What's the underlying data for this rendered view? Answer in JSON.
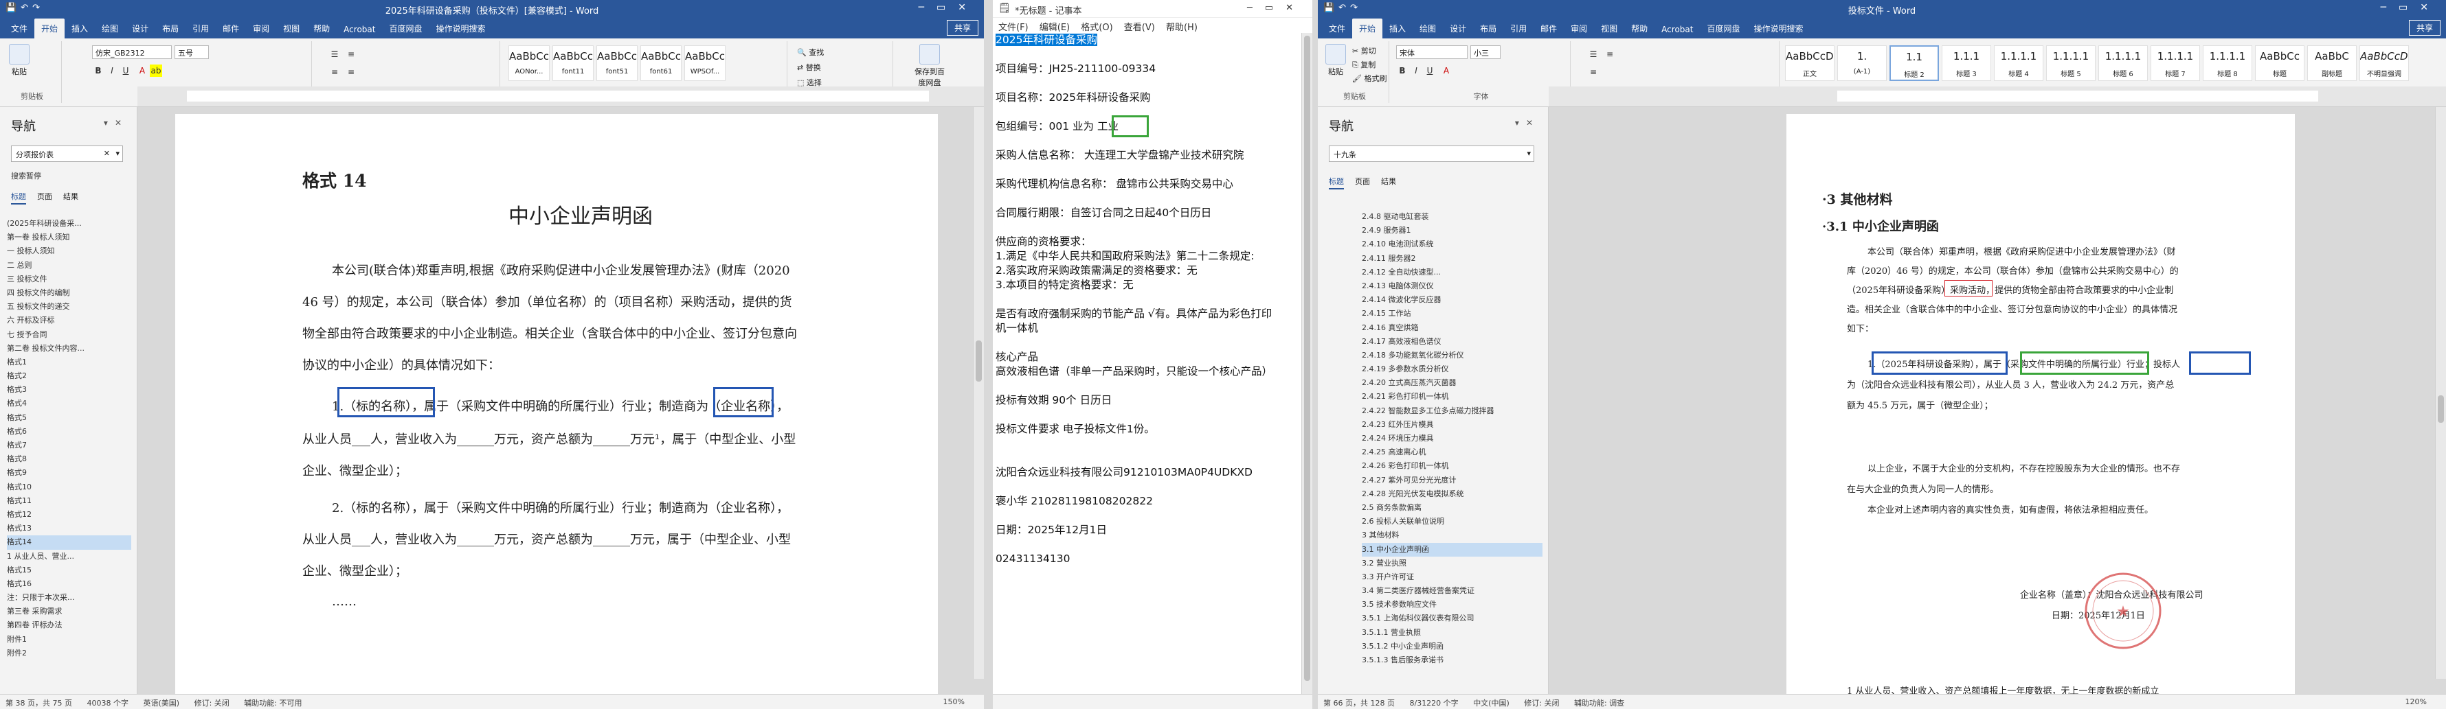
{
  "left_word": {
    "title": "2025年科研设备采购（投标文件）[兼容模式] - Word",
    "share": "共享",
    "tabs": [
      "文件",
      "开始",
      "插入",
      "绘图",
      "设计",
      "布局",
      "引用",
      "邮件",
      "审阅",
      "视图",
      "帮助",
      "Acrobat",
      "百度网盘",
      "操作说明搜索"
    ],
    "font_name": "仿宋_GB2312",
    "font_size": "五号",
    "styles": [
      {
        "preview": "AaBbCcDd",
        "name": "AONor..."
      },
      {
        "preview": "AaBbCcDd",
        "name": "font11"
      },
      {
        "preview": "AaBbCcDd",
        "name": "font51"
      },
      {
        "preview": "AaBbCcDd",
        "name": "font61"
      },
      {
        "preview": "AaBbCcDd",
        "name": "WPSOf..."
      }
    ],
    "ribbon_groups": {
      "clipboard": "剪贴板",
      "font": "字体",
      "paragraph": "段落",
      "styles": "样式",
      "edit": "编辑",
      "save": "保存",
      "paste": "粘贴",
      "find": "查找",
      "replace": "替换",
      "select": "选择",
      "save_to_baidu": "保存到百度网盘"
    },
    "nav": {
      "title": "导航",
      "search": "分项报价表",
      "results_label": "搜索暂停",
      "tabs": [
        "标题",
        "页面",
        "结果"
      ],
      "items": [
        "(2025年科研设备采...",
        "第一卷 投标人须知",
        "一 投标人须知",
        "二 总则",
        "三 投标文件",
        "四 投标文件的编制",
        "五 投标文件的递交",
        "六 开标及评标",
        "七 授予合同",
        "第二卷 投标文件内容...",
        "格式1",
        "格式2",
        "格式3",
        "格式4",
        "格式5",
        "格式6",
        "格式7",
        "格式8",
        "格式9",
        "格式10",
        "格式11",
        "格式12",
        "格式13",
        "格式14",
        "1 从业人员、营业...",
        "格式15",
        "格式16",
        "注：只限于本次采...",
        "第三卷 采购需求",
        "第四卷 评标办法",
        "附件1",
        "附件2"
      ],
      "selected_index": 23
    },
    "doc": {
      "heading": "格式 14",
      "title": "中小企业声明函",
      "body": [
        "本公司(联合体)郑重声明,根据《政府采购促进中小企业发展管理办法》(财库（2020",
        "46 号）的规定，本公司（联合体）参加（单位名称）的（项目名称）采购活动，提供的货",
        "物全部由符合政策要求的中小企业制造。相关企业（含联合体中的中小企业、签订分包意向",
        "协议的中小企业）的具体情况如下："
      ],
      "item1_a": "1.（标的名称），属于（采购文件中明确的所属行业）行业；制造商为（企业名称），",
      "item1_b": "从业人员___人，营业收入为______万元，资产总额为______万元¹，属于（中型企业、小型",
      "item1_c": "企业、微型企业）；",
      "item2_a": "2.（标的名称），属于（采购文件中明确的所属行业）行业；制造商为（企业名称），",
      "item2_b": "从业人员___人，营业收入为______万元，资产总额为______万元，属于（中型企业、小型",
      "item2_c": "企业、微型企业）；",
      "ellipsis": "……"
    },
    "status": {
      "page": "第 38 页，共 75 页",
      "words": "40038 个字",
      "lang": "英语(美国)",
      "track": "修订: 关闭",
      "access": "辅助功能: 不可用",
      "zoom": "150%"
    }
  },
  "notepad": {
    "title": "*无标题 - 记事本",
    "menu": [
      "文件(F)",
      "编辑(E)",
      "格式(O)",
      "查看(V)",
      "帮助(H)"
    ],
    "lines": [
      "2025年科研设备采购",
      "",
      "项目编号：JH25-211100-09334",
      "",
      "项目名称：2025年科研设备采购",
      "",
      "包组编号：001     业为  工业",
      "",
      "采购人信息名称：  大连理工大学盘锦产业技术研究院",
      "",
      "采购代理机构信息名称：    盘锦市公共采购交易中心",
      "",
      "合同履行期限：自签订合同之日起40个日历日",
      "",
      "供应商的资格要求：",
      "1.满足《中华人民共和国政府采购法》第二十二条规定:",
      "2.落实政府采购政策需满足的资格要求：无",
      "3.本项目的特定资格要求：无",
      "",
      "是否有政府强制采购的节能产品   √有。具体产品为彩色打印",
      "机一体机",
      "",
      "核心产品",
      "高效液相色谱（非单一产品采购时，只能设一个核心产品）",
      "",
      "投标有效期  90个  日历日",
      "",
      "投标文件要求   电子投标文件1份。",
      "",
      "",
      "沈阳合众远业科技有限公司91210103MA0P4UDKXD",
      "",
      "褒小华 210281198108202822",
      "",
      "日期：2025年12月1日",
      "",
      "02431134130"
    ]
  },
  "right_word": {
    "title": "投标文件 - Word",
    "share": "共享",
    "tabs": [
      "文件",
      "开始",
      "插入",
      "绘图",
      "设计",
      "布局",
      "引用",
      "邮件",
      "审阅",
      "视图",
      "帮助",
      "Acrobat",
      "百度网盘",
      "操作说明搜索"
    ],
    "font_name": "宋体",
    "font_size": "小三",
    "styles": [
      {
        "preview": "AaBbCcDd",
        "name": "正文"
      },
      {
        "preview": "1.",
        "name": "(A-1)"
      },
      {
        "preview": "1.1",
        "name": "标题 2"
      },
      {
        "preview": "1.1.1",
        "name": "标题 3"
      },
      {
        "preview": "1.1.1.1",
        "name": "标题 4"
      },
      {
        "preview": "1.1.1.1",
        "name": "标题 5"
      },
      {
        "preview": "1.1.1.1",
        "name": "标题 6"
      },
      {
        "preview": "1.1.1.1",
        "name": "标题 7"
      },
      {
        "preview": "1.1.1.1",
        "name": "标题 8"
      },
      {
        "preview": "AaBbCc",
        "name": "标题"
      },
      {
        "preview": "AaBbC",
        "name": "副标题"
      },
      {
        "preview": "AaBbCcDd",
        "name": "不明显强调"
      }
    ],
    "ribbon_groups": {
      "clipboard": "剪贴板",
      "font": "字体",
      "paragraph": "段落",
      "styles": "样式",
      "cut": "剪切",
      "copy": "复制",
      "format": "格式刷",
      "paste": "粘贴"
    },
    "nav": {
      "title": "导航",
      "search": "十九条",
      "tabs": [
        "标题",
        "页面",
        "结果"
      ],
      "items": [
        "2.4.8 驱动电缸套装",
        "2.4.9 服务器1",
        "2.4.10 电池测试系统",
        "2.4.11 服务器2",
        "2.4.12 全自动快速型...",
        "2.4.13 电脑体测仪仪",
        "2.4.14 微波化学反应器",
        "2.4.15 工作站",
        "2.4.16 真空烘箱",
        "2.4.17 高效液相色谱仪",
        "2.4.18 多功能氮氧化碳分析仪",
        "2.4.19 多参数水质分析仪",
        "2.4.20 立式高压蒸汽灭菌器",
        "2.4.21 彩色打印机一体机",
        "2.4.22 智能数显多工位多点磁力搅拌器",
        "2.4.23 红外压片模具",
        "2.4.24 环境压力模具",
        "2.4.25 高速离心机",
        "2.4.26 彩色打印机一体机",
        "2.4.27 紫外可见分光光度计",
        "2.4.28 光阳光伏发电模拟系统",
        "2.5 商务条款偏离",
        "2.6 投标人关联单位说明",
        "3 其他材料",
        "3.1 中小企业声明函",
        "3.2 营业执照",
        "3.3 开户许可证",
        "3.4 第二类医疗器械经营备案凭证",
        "3.5 技术参数响应文件",
        "3.5.1 上海佑科仪器仪表有限公司",
        "3.5.1.1 营业执照",
        "3.5.1.2 中小企业声明函",
        "3.5.1.3 售后服务承诺书"
      ],
      "selected_index": 24
    },
    "doc": {
      "h3": "·3  其他材料",
      "h31": "·3.1  中小企业声明函",
      "body": [
        "本公司（联合体）郑重声明，根据《政府采购促进中小企业发展管理办法》（财",
        "库（2020）46 号）的规定，本公司（联合体）参加（盘锦市公共采购交易中心）的",
        "（2025年科研设备采购）采购活动，提供的货物全部由符合政策要求的中小企业制",
        "造。相关企业（含联合体中的中小企业、签订分包意向协议的中小企业）的具体情况",
        "如下："
      ],
      "item1_a": "1.（2025年科研设备采购），属于（采购文件中明确的所属行业）行业；投标人",
      "item1_b": "为（沈阳合众远业科技有限公司），从业人员 3 人，营业收入为 24.2 万元，资产总",
      "item1_c": "额为 45.5 万元，属于（微型企业）；",
      "p2": "以上企业，不属于大企业的分支机构，不存在控股股东为大企业的情形。也不存",
      "p3": "在与大企业的负责人为同一人的情形。",
      "p4": "本企业对上述声明内容的真实性负责，如有虚假，将依法承担相应责任。",
      "sign1": "企业名称（盖章）：沈阳合众远业科技有限公司",
      "sign2": "日期：2025年12月1日",
      "foot": "1 从业人员、营业收入、资产总额填报上一年度数据，无上一年度数据的新成立"
    },
    "status": {
      "page": "第 66 页，共 128 页",
      "words": "8/31220 个字",
      "lang": "中文(中国)",
      "track": "修订: 关闭",
      "access": "辅助功能: 调查",
      "zoom": "120%"
    }
  },
  "colors": {
    "word_blue": "#2b579a",
    "box_blue": "#2456b3",
    "box_green": "#3aa53a",
    "box_red": "#d4242b",
    "stamp": "#d23b3b"
  }
}
